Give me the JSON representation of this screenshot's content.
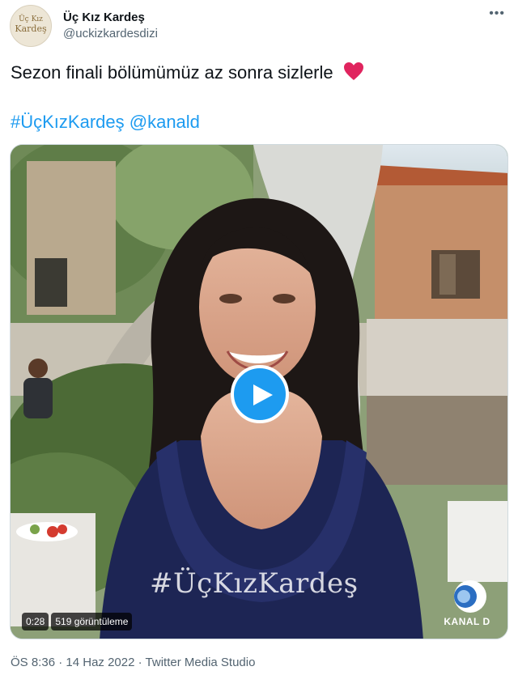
{
  "account": {
    "name": "Üç Kız Kardeş",
    "handle": "@uckizkardesdizi",
    "avatar_line1": "Üç Kız",
    "avatar_line2": "Kardeş"
  },
  "tweet": {
    "text": "Sezon finali bölümümüz az sonra sizlerle",
    "hashtag": "#ÜçKızKardeş",
    "mention": "@kanald",
    "heart_icon": "red-heart-emoji"
  },
  "video": {
    "overlay_hashtag": "#ÜçKızKardeş",
    "duration": "0:28",
    "views": "519 görüntüleme",
    "channel": "KANAL D"
  },
  "footer": {
    "time": "ÖS 8:36",
    "date": "14 Haz 2022",
    "source": "Twitter Media Studio",
    "separator": "·"
  },
  "colors": {
    "link": "#1d9bf0",
    "secondary_text": "#536471",
    "play_button": "#1d9bf0",
    "heart": "#e0245e"
  }
}
